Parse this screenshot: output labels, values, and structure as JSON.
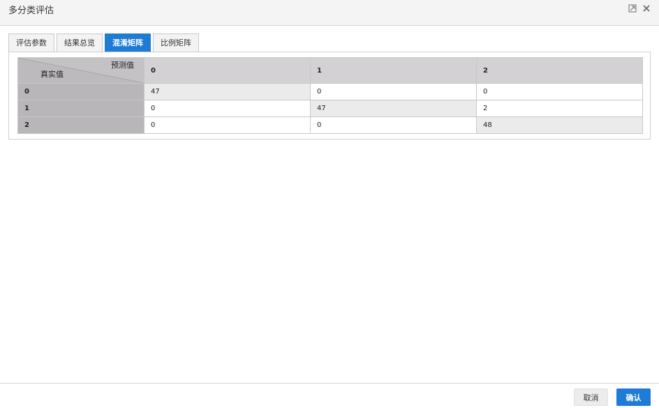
{
  "window": {
    "title": "多分类评估",
    "buttons": [
      "restore-icon",
      "close-icon"
    ]
  },
  "tabs": [
    {
      "label": "评估参数",
      "active": false
    },
    {
      "label": "结果总览",
      "active": false
    },
    {
      "label": "混淆矩阵",
      "active": true
    },
    {
      "label": "比例矩阵",
      "active": false
    }
  ],
  "matrix": {
    "corner_predicted": "预测值",
    "corner_actual": "真实值",
    "columns": [
      "0",
      "1",
      "2"
    ],
    "rows": [
      {
        "label": "0",
        "cells": [
          "47",
          "0",
          "0"
        ]
      },
      {
        "label": "1",
        "cells": [
          "0",
          "47",
          "2"
        ]
      },
      {
        "label": "2",
        "cells": [
          "0",
          "0",
          "48"
        ]
      }
    ]
  },
  "footer": {
    "cancel_label": "取消",
    "confirm_label": "确认"
  },
  "colors": {
    "accent": "#1e7bd6",
    "header_bg": "#d3d1d3",
    "rowhead_bg": "#b8b6b8",
    "diag_bg": "#ebebeb"
  }
}
